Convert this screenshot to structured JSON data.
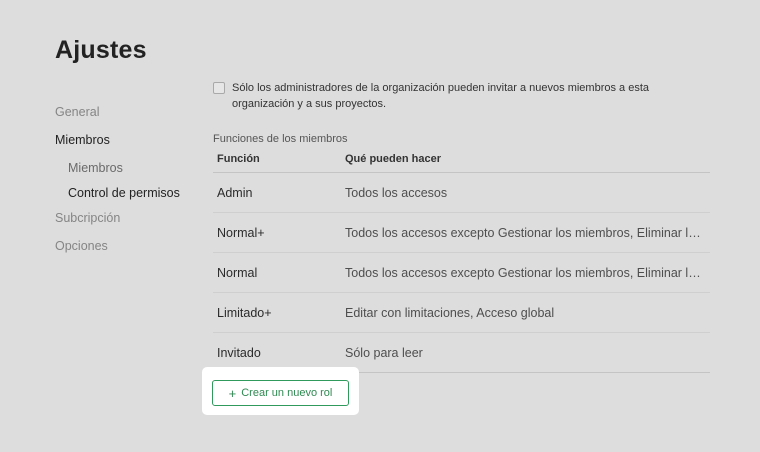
{
  "page": {
    "title": "Ajustes"
  },
  "sidebar": {
    "items": [
      {
        "label": "General"
      },
      {
        "label": "Miembros"
      },
      {
        "label": "Miembros"
      },
      {
        "label": "Control de permisos"
      },
      {
        "label": "Subcripción"
      },
      {
        "label": "Opciones"
      }
    ]
  },
  "settings": {
    "invite_only_admins_label": "Sólo los administradores de la organización pueden invitar a nuevos miembros a esta organización y a sus proyectos.",
    "invite_only_admins_checked": false
  },
  "roles": {
    "section_label": "Funciones de los miembros",
    "columns": [
      "Función",
      "Qué pueden hacer"
    ],
    "rows": [
      {
        "role": "Admin",
        "permissions": "Todos los accesos"
      },
      {
        "role": "Normal+",
        "permissions": "Todos los accesos excepto Gestionar los miembros, Eliminar los proyectos"
      },
      {
        "role": "Normal",
        "permissions": "Todos los accesos excepto Gestionar los miembros, Eliminar los proyectos"
      },
      {
        "role": "Limitado+",
        "permissions": "Editar con limitaciones, Acceso global"
      },
      {
        "role": "Invitado",
        "permissions": "Sólo para leer"
      }
    ],
    "create_button_label": "Crear un nuevo rol",
    "create_button_icon": "plus-icon"
  },
  "colors": {
    "background": "#dddddd",
    "accent": "#2f9a5c",
    "highlight": "#ffffff"
  }
}
